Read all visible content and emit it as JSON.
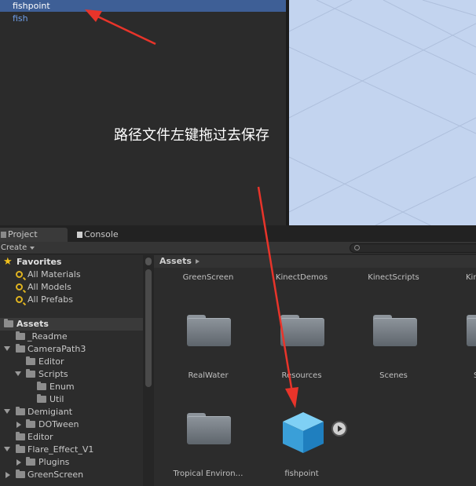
{
  "hierarchy": {
    "items": [
      {
        "label": "fishpoint",
        "selected": true
      },
      {
        "label": "fish",
        "selected": false
      }
    ]
  },
  "annotation": {
    "text": "路径文件左键拖过去保存"
  },
  "tabs": [
    {
      "label": "Project",
      "icon": "project-icon",
      "active": true
    },
    {
      "label": "Console",
      "icon": "console-icon",
      "active": false
    }
  ],
  "toolbar": {
    "create_label": "Create"
  },
  "tree": {
    "favorites": {
      "label": "Favorites",
      "items": [
        "All Materials",
        "All Models",
        "All Prefabs"
      ]
    },
    "assets_label": "Assets",
    "nodes": [
      {
        "label": "_Readme"
      },
      {
        "label": "CameraPath3"
      },
      {
        "label": "Editor"
      },
      {
        "label": "Scripts"
      },
      {
        "label": "Enum"
      },
      {
        "label": "Util"
      },
      {
        "label": "Demigiant"
      },
      {
        "label": "DOTween"
      },
      {
        "label": "Editor"
      },
      {
        "label": "Flare_Effect_V1"
      },
      {
        "label": "Plugins"
      },
      {
        "label": "GreenScreen"
      }
    ]
  },
  "grid": {
    "breadcrumb": "Assets",
    "top_labels": [
      "GreenScreen",
      "KinectDemos",
      "KinectScripts",
      "Kin"
    ],
    "row2_labels": [
      "RealWater",
      "Resources",
      "Scenes",
      "S"
    ],
    "row3_labels": [
      "Tropical Environ…",
      "fishpoint"
    ]
  },
  "colors": {
    "selection": "#3e5f96",
    "prefab_text": "#6e9ee8",
    "scene_bg": "#c3d4ef",
    "arrow": "#e8342a"
  }
}
